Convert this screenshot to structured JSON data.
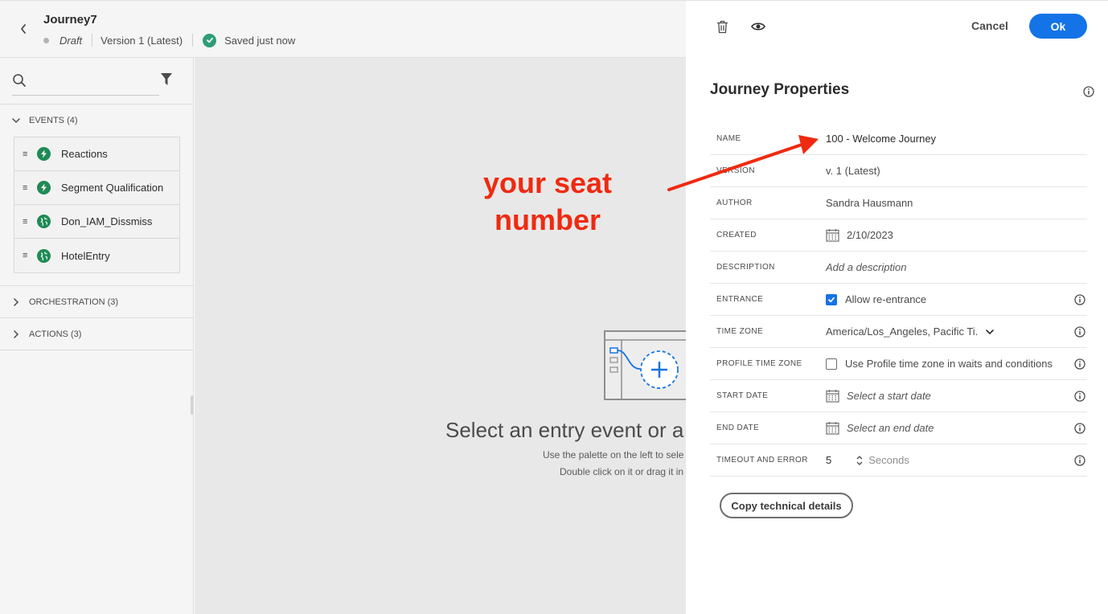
{
  "header": {
    "title": "Journey7",
    "status": "Draft",
    "version": "Version 1 (Latest)",
    "saved": "Saved just now"
  },
  "palette": {
    "search_placeholder": "",
    "events_header": "EVENTS (4)",
    "events": [
      {
        "label": "Reactions",
        "icon": "lightning-icon"
      },
      {
        "label": "Segment Qualification",
        "icon": "lightning-icon"
      },
      {
        "label": "Don_IAM_Dissmiss",
        "icon": "globe-icon"
      },
      {
        "label": "HotelEntry",
        "icon": "globe-icon"
      }
    ],
    "orchestration_header": "ORCHESTRATION (3)",
    "actions_header": "ACTIONS (3)"
  },
  "canvas": {
    "title": "Select an entry event or a re",
    "line1": "Use the palette on the left to sele",
    "line2": "Double click on it or drag it in"
  },
  "annotation": {
    "line1": "your seat",
    "line2": "number",
    "color": "#ef2a10"
  },
  "properties": {
    "cancel_label": "Cancel",
    "ok_label": "Ok",
    "title": "Journey Properties",
    "name_label": "NAME",
    "name_value": "100 - Welcome Journey",
    "version_label": "VERSION",
    "version_value": "v. 1 (Latest)",
    "author_label": "AUTHOR",
    "author_value": "Sandra Hausmann",
    "created_label": "CREATED",
    "created_value": "2/10/2023",
    "description_label": "DESCRIPTION",
    "description_placeholder": "Add a description",
    "entrance_label": "ENTRANCE",
    "entrance_value": "Allow re-entrance",
    "timezone_label": "TIME ZONE",
    "timezone_value": "America/Los_Angeles, Pacific Ti...",
    "profile_tz_label": "PROFILE TIME ZONE",
    "profile_tz_value": "Use Profile time zone in waits and conditions",
    "start_label": "START DATE",
    "start_placeholder": "Select a start date",
    "end_label": "END DATE",
    "end_placeholder": "Select an end date",
    "timeout_label": "TIMEOUT AND ERROR",
    "timeout_value": "5",
    "timeout_unit": "Seconds",
    "copy_label": "Copy technical details"
  },
  "colors": {
    "accent": "#1473e6",
    "saved_green": "#2d9d78",
    "event_green": "#1f8a55"
  }
}
